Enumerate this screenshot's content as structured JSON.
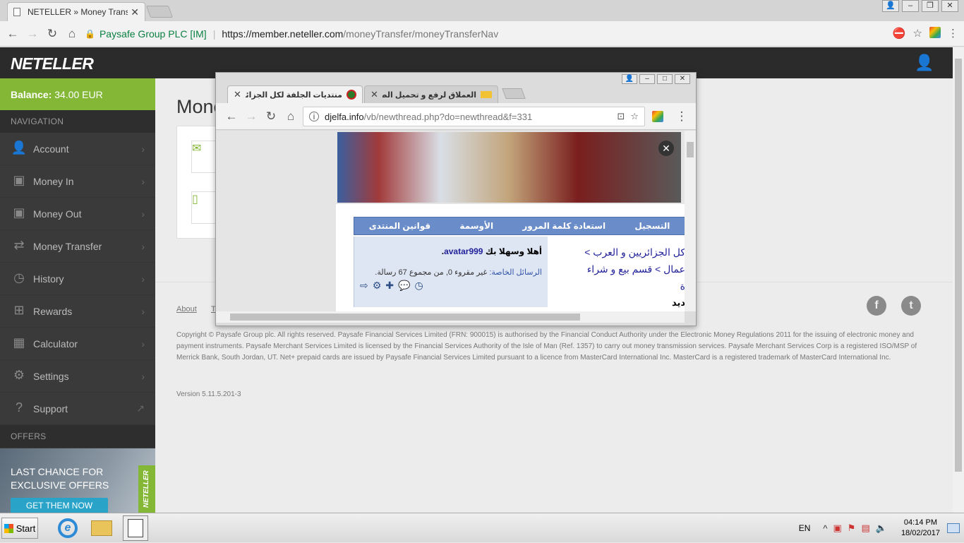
{
  "browser": {
    "tab_title": "NETELLER » Money Transfer",
    "secure_org": "Paysafe Group PLC [IM]",
    "url_host": "https://member.neteller.com",
    "url_path": "/moneyTransfer/moneyTransferNav"
  },
  "neteller": {
    "logo": "NETELLER",
    "balance_label": "Balance:",
    "balance_value": "34.00 EUR",
    "nav_heading": "NAVIGATION",
    "nav_items": [
      {
        "label": "Account",
        "icon": "user-icon"
      },
      {
        "label": "Money In",
        "icon": "money-in-icon"
      },
      {
        "label": "Money Out",
        "icon": "money-out-icon"
      },
      {
        "label": "Money Transfer",
        "icon": "transfer-icon"
      },
      {
        "label": "History",
        "icon": "clock-icon"
      },
      {
        "label": "Rewards",
        "icon": "gift-icon"
      },
      {
        "label": "Calculator",
        "icon": "calculator-icon"
      },
      {
        "label": "Settings",
        "icon": "gear-icon"
      },
      {
        "label": "Support",
        "icon": "question-icon"
      }
    ],
    "offers_heading": "OFFERS",
    "promo_line1": "LAST CHANCE FOR",
    "promo_line2": "EXCLUSIVE OFFERS",
    "promo_button": "GET THEM NOW",
    "promo_brand": "NETELLER",
    "page_title": "Mone",
    "footer_link": "About",
    "footer_link2": "T",
    "copyright": "Copyright © Paysafe Group plc. All rights reserved. Paysafe Financial Services Limited (FRN: 900015) is authorised by the Financial Conduct Authority under the Electronic Money Regulations 2011 for the issuing of electronic money and payment instruments. Paysafe Merchant Services Limited is licensed by the Financial Services Authority of the Isle of Man (Ref. 1357) to carry out money transmission services. Paysafe Merchant Services Corp is a registered ISO/MSP of Merrick Bank, South Jordan, UT. Net+ prepaid cards are issued by Paysafe Financial Services Limited pursuant to a licence from MasterCard International Inc. MasterCard is a registered trademark of MasterCard International Inc.",
    "version": "Version 5.11.5.201-3",
    "social_facebook": "f",
    "social_twitter": "t"
  },
  "popup": {
    "tab_active": "منتديات الجلفة لكل الجزائريين و",
    "tab_inactive": "العملاق لرفع و تحميل الصور",
    "url_host": "djelfa.info",
    "url_path": "/vb/newthread.php?do=newthread&f=331",
    "forum_nav": [
      "التسجيل",
      "استعادة كلمة المرور",
      "الأوسمة",
      "قوانين المنتدى"
    ],
    "welcome_prefix": "أهلا وسهلا بك",
    "username": "avatar999",
    "pm_label": "الرسائل الخاصة:",
    "pm_text": "غير مقروء 0, من مجموع 67 رسالة.",
    "breadcrumb_1": "كل الجزائريين و العرب >",
    "breadcrumb_2": "عمال > قسم بيع و شراء",
    "breadcrumb_3": "ة",
    "breadcrumb_4": "ديد"
  },
  "taskbar": {
    "start_label": "Start",
    "lang": "EN",
    "time": "04:14 PM",
    "date": "18/02/2017"
  }
}
